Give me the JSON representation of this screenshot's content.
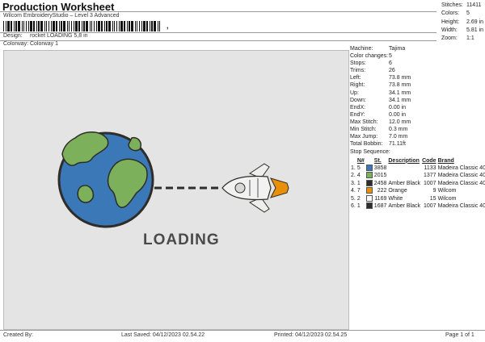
{
  "header": {
    "title": "Production Worksheet",
    "subtitle": "Wilcom EmbroideryStudio – Level 3 Advanced",
    "barcode_suffix": ","
  },
  "meta": {
    "design_label": "Design:",
    "design_value": "rocket LOADING 5,8 in",
    "colorway_label": "Colorway:",
    "colorway_value": "Colorway 1"
  },
  "stats": [
    {
      "label": "Stitches:",
      "value": "11411"
    },
    {
      "label": "Colors:",
      "value": "5"
    },
    {
      "label": "Height:",
      "value": "2.69 in"
    },
    {
      "label": "Width:",
      "value": "5.81 in"
    },
    {
      "label": "Zoom:",
      "value": "1:1"
    }
  ],
  "machine_info": [
    {
      "label": "Machine:",
      "value": "Tajima"
    },
    {
      "label": "Color changes:",
      "value": "5"
    },
    {
      "label": "Stops:",
      "value": "6"
    },
    {
      "label": "Trims:",
      "value": "26"
    },
    {
      "label": "Left:",
      "value": "73.8 mm"
    },
    {
      "label": "Right:",
      "value": "73.8 mm"
    },
    {
      "label": "Up:",
      "value": "34.1 mm"
    },
    {
      "label": "Down:",
      "value": "34.1 mm"
    },
    {
      "label": "EndX:",
      "value": "0.00 in"
    },
    {
      "label": "EndY:",
      "value": "0.00 in"
    },
    {
      "label": "Max Stitch:",
      "value": "12.0 mm"
    },
    {
      "label": "Min Stitch:",
      "value": "0.3 mm"
    },
    {
      "label": "Max Jump:",
      "value": "7.0 mm"
    },
    {
      "label": "Total Bobbin:",
      "value": "71.11ft"
    }
  ],
  "stop_sequence": {
    "title": "Stop Sequence:",
    "headers": {
      "n": "N#",
      "st": "St.",
      "desc": "Description",
      "code": "Code",
      "brand": "Brand"
    },
    "rows": [
      {
        "stop": "1.",
        "n": "5",
        "color": "#3a78b8",
        "st": "3858",
        "desc": "",
        "code": "1133",
        "brand": "Madeira Classic 40"
      },
      {
        "stop": "2.",
        "n": "4",
        "color": "#7db05a",
        "st": "2015",
        "desc": "",
        "code": "1377",
        "brand": "Madeira Classic 40"
      },
      {
        "stop": "3.",
        "n": "1",
        "color": "#2e2d29",
        "st": "2458",
        "desc": "Amber Black",
        "code": "1007",
        "brand": "Madeira Classic 40"
      },
      {
        "stop": "4.",
        "n": "7",
        "color": "#e8900a",
        "st": "222",
        "desc": "Orange",
        "code": "9",
        "brand": "Wilcom"
      },
      {
        "stop": "5.",
        "n": "2",
        "color": "#ffffff",
        "st": "1169",
        "desc": "White",
        "code": "15",
        "brand": "Wilcom"
      },
      {
        "stop": "6.",
        "n": "1",
        "color": "#2e2d29",
        "st": "1687",
        "desc": "Amber Black",
        "code": "1007",
        "brand": "Madeira Classic 40"
      }
    ]
  },
  "artwork": {
    "text": "LOADING",
    "colors": {
      "ocean": "#3a78b8",
      "land": "#7db05a",
      "outline": "#2e2d29",
      "flame": "#e8900a",
      "body": "#ffffff",
      "text": "#4a4a4a"
    }
  },
  "footer": {
    "created_by": "Created By:",
    "last_saved": "Last Saved: 04/12/2023 02.54.22",
    "printed": "Printed: 04/12/2023 02.54.25",
    "page": "Page 1 of 1"
  }
}
